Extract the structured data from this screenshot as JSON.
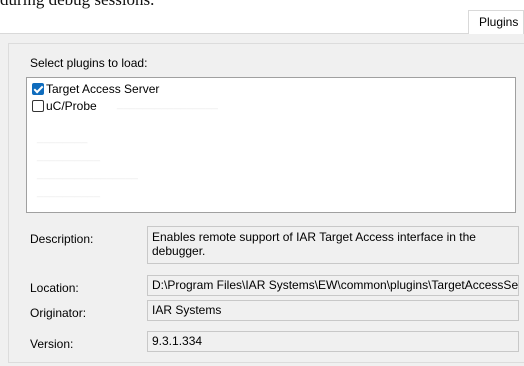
{
  "header": {
    "top_text": "during debug sessions."
  },
  "tabs": [
    {
      "label": "Plugins",
      "active": true
    }
  ],
  "plugins": {
    "select_label": "Select plugins to load:",
    "items": [
      {
        "label": "Target Access Server",
        "checked": true
      },
      {
        "label": "uC/Probe",
        "checked": false
      }
    ]
  },
  "details": {
    "description_label": "Description:",
    "description_value": "Enables remote support of IAR Target Access interface in the debugger.",
    "location_label": "Location:",
    "location_value": "D:\\Program Files\\IAR Systems\\EW\\common\\plugins\\TargetAccessServer",
    "originator_label": "Originator:",
    "originator_value": "IAR Systems",
    "version_label": "Version:",
    "version_value": "9.3.1.334"
  },
  "colors": {
    "panel_bg": "#f0f0f0",
    "checkbox_checked": "#0f6cbd",
    "list_bg": "#ffffff"
  }
}
